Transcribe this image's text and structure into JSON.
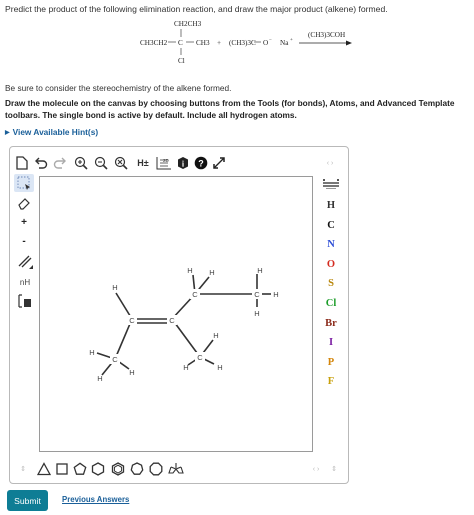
{
  "question": {
    "prompt": "Predict the product of the following elimination reaction, and draw the major product (alkene) formed.",
    "reaction": {
      "top_substituent": "CH2CH3",
      "main_chain_left": "CH3CH2",
      "central_carbon": "C",
      "main_chain_right": "CH3",
      "bottom_substituent": "Cl",
      "plus": "+",
      "base": "(CH3)3C",
      "base_charge": "O",
      "counter_ion": "Na",
      "solvent": "(CH3)3COH"
    },
    "stereo_note": "Be sure to consider the stereochemistry of the alkene formed.",
    "instructions": "Draw the molecule on the canvas by choosing buttons from the Tools (for bonds), Atoms, and Advanced Template toolbars. The single bond is active by default. Include all hydrogen atoms.",
    "hints_link": "View Available Hint(s)"
  },
  "toolbar": {
    "top_icons": [
      "new-document-icon",
      "undo-icon",
      "redo-icon",
      "zoom-in-icon",
      "zoom-out-icon",
      "clear-icon",
      "explicit-hydrogens-icon",
      "2d-structure-icon",
      "info-icon",
      "help-icon",
      "fullscreen-icon"
    ],
    "h_toggle_label": "H±",
    "left_icons": [
      "select-icon",
      "eraser-icon",
      "plus-charge-icon",
      "minus-charge-icon",
      "bond-icon",
      "chain-icon",
      "template-icon"
    ],
    "plus_label": "+",
    "minus_label": "-",
    "chain_label": "nH",
    "atoms": [
      {
        "symbol": "H",
        "color": "#333333"
      },
      {
        "symbol": "C",
        "color": "#111111"
      },
      {
        "symbol": "N",
        "color": "#2f4fd6"
      },
      {
        "symbol": "O",
        "color": "#d42b1f"
      },
      {
        "symbol": "S",
        "color": "#b8860b"
      },
      {
        "symbol": "Cl",
        "color": "#1e9e2b"
      },
      {
        "symbol": "Br",
        "color": "#8b2a1a"
      },
      {
        "symbol": "I",
        "color": "#7b1fa2"
      },
      {
        "symbol": "P",
        "color": "#d4860b"
      },
      {
        "symbol": "F",
        "color": "#c8a00b"
      }
    ],
    "periodic_table_icon": "periodic-table-icon",
    "bottom_shapes": [
      "cyclopropane",
      "cyclobutane",
      "cyclopentane",
      "cyclohexane",
      "benzene",
      "cycloheptane",
      "cyclooctane",
      "chair-template"
    ]
  },
  "molecule": {
    "atoms": [
      "C",
      "C",
      "C",
      "C",
      "C",
      "C",
      "H",
      "H",
      "H",
      "H",
      "H",
      "H",
      "H",
      "H",
      "H",
      "H",
      "H",
      "H"
    ],
    "colors": {
      "bond": "#333333",
      "label": "#444444"
    }
  },
  "footer": {
    "submit_label": "Submit",
    "previous_label": "Previous Answers"
  }
}
